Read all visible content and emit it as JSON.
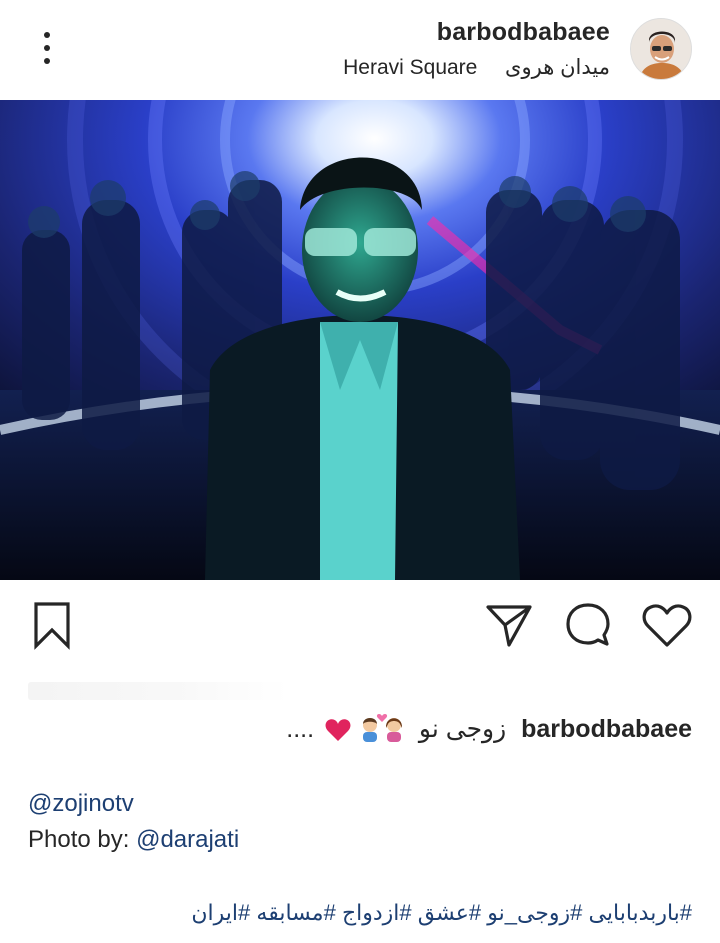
{
  "header": {
    "username": "barbodbabaee",
    "location_fa": "میدان هروی",
    "location_en": "Heravi Square"
  },
  "colors": {
    "link": "#1d3f72",
    "text": "#262626",
    "heart": "#e0245e"
  },
  "icons": {
    "more": "more-vertical-icon",
    "save": "bookmark-icon",
    "share": "send-icon",
    "comment": "comment-icon",
    "like": "heart-icon"
  },
  "caption": {
    "username": "barbodbabaee",
    "text": "زوجی نو",
    "ellipsis": "...."
  },
  "mention": "@zojinotv",
  "photo_by": {
    "prefix": "Photo by:",
    "handle": "@darajati"
  },
  "hashtags": [
    "#باربدبابایی",
    "#زوجی_نو",
    "#عشق",
    "#ازدواج",
    "#مسابقه",
    "#ایران"
  ]
}
